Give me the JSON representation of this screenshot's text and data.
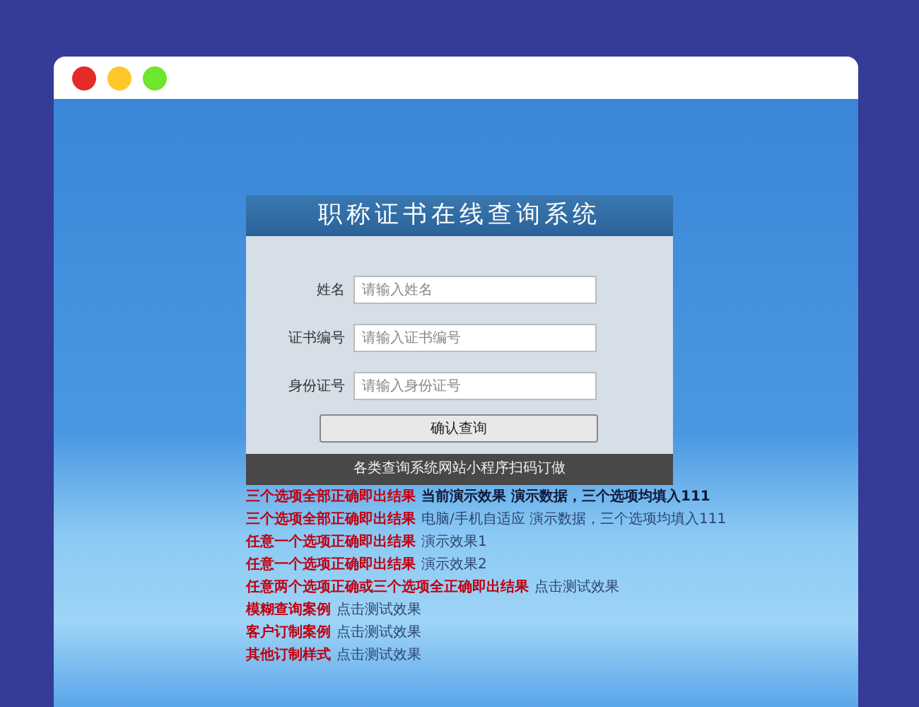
{
  "window": {
    "controls": [
      {
        "color": "#e52a2a"
      },
      {
        "color": "#fdc72a"
      },
      {
        "color": "#6ee62e"
      }
    ]
  },
  "form": {
    "title": "职称证书在线查询系统",
    "fields": [
      {
        "label": "姓名",
        "placeholder": "请输入姓名"
      },
      {
        "label": "证书编号",
        "placeholder": "请输入证书编号"
      },
      {
        "label": "身份证号",
        "placeholder": "请输入身份证号"
      }
    ],
    "submit": "确认查询",
    "footer": "各类查询系统网站小程序扫码订做"
  },
  "links": [
    {
      "title": "三个选项全部正确即出结果",
      "note": "当前演示效果 演示数据，三个选项均填入111",
      "kind": "dark"
    },
    {
      "title": "三个选项全部正确即出结果",
      "note": "电脑/手机自适应 演示数据，三个选项均填入111",
      "kind": "muted"
    },
    {
      "title": "任意一个选项正确即出结果",
      "note": "演示效果1",
      "kind": "muted"
    },
    {
      "title": "任意一个选项正确即出结果",
      "note": "演示效果2",
      "kind": "muted"
    },
    {
      "title": "任意两个选项正确或三个选项全正确即出结果",
      "note": "点击测试效果",
      "kind": "muted"
    },
    {
      "title": "模糊查询案例",
      "note": "点击测试效果",
      "kind": "muted"
    },
    {
      "title": "客户订制案例",
      "note": "点击测试效果",
      "kind": "muted"
    },
    {
      "title": "其他订制样式",
      "note": "点击测试效果",
      "kind": "muted"
    }
  ]
}
